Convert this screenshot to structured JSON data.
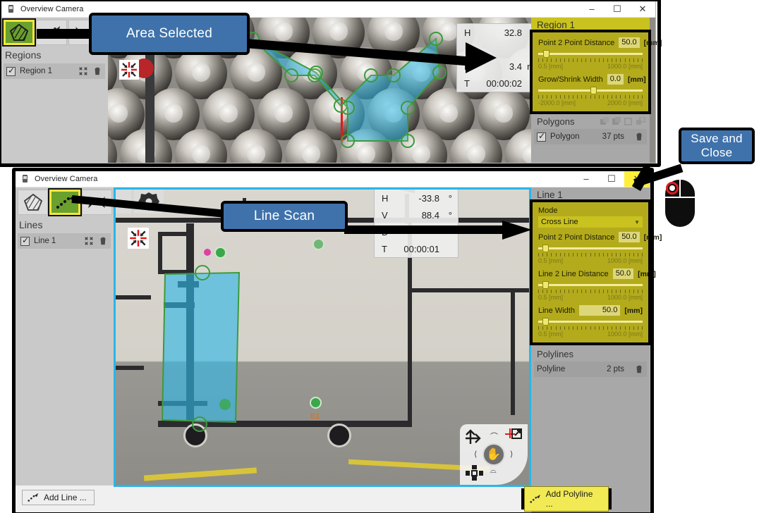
{
  "upper_window": {
    "title": "Overview Camera",
    "titlebar_icon": "camera-icon",
    "buttons": {
      "minimize": "–",
      "maximize": "☐",
      "close": "✕"
    },
    "toolbar": [
      {
        "name": "polygon-tool",
        "icon": "polygon-icon",
        "selected": true
      },
      {
        "name": "line-tool",
        "icon": "line-dots-icon",
        "selected": false
      },
      {
        "name": "curve-tool",
        "icon": "curve-icon",
        "selected": false
      }
    ],
    "sidebar": {
      "section_title": "Regions",
      "items": [
        {
          "label": "Region 1",
          "checked": true,
          "fit_icon": "fit-icon",
          "delete_icon": "trash-icon"
        }
      ]
    },
    "fit_overlay_icon": "fit-to-view-icon",
    "readout": [
      {
        "key": "H",
        "value": "32.8",
        "unit": "°"
      },
      {
        "key": "D",
        "value": "3.4",
        "unit": "m"
      },
      {
        "key": "T",
        "value": "00:00:02",
        "unit": ""
      }
    ],
    "properties": {
      "title": "Region 1",
      "fields": [
        {
          "label": "Point 2 Point Distance",
          "value": "50.0",
          "unit": "[mm]",
          "min": "0.5 [mm]",
          "max": "1000.0 [mm]",
          "knob_pct": 5
        },
        {
          "label": "Grow/Shrink Width",
          "value": "0.0",
          "unit": "[mm]",
          "min": "-2000.0 [mm]",
          "max": "2000.0 [mm]",
          "knob_pct": 50
        }
      ]
    },
    "polygons": {
      "header": "Polygons",
      "items": [
        {
          "label": "Polygon",
          "count": "37 pts",
          "checked": true,
          "delete_icon": "trash-icon"
        }
      ]
    }
  },
  "lower_window": {
    "title": "Overview Camera",
    "titlebar_icon": "camera-icon",
    "buttons": {
      "minimize": "–",
      "maximize": "☐",
      "close": "✕"
    },
    "close_highlighted": true,
    "toolbar": [
      {
        "name": "polygon-tool",
        "icon": "polygon-icon",
        "selected": false
      },
      {
        "name": "line-tool",
        "icon": "line-dots-icon",
        "selected": true
      },
      {
        "name": "curve-tool",
        "icon": "curve-icon",
        "selected": false
      }
    ],
    "sidebar": {
      "section_title": "Lines",
      "items": [
        {
          "label": "Line 1",
          "checked": true,
          "fit_icon": "fit-icon",
          "delete_icon": "trash-icon"
        }
      ]
    },
    "viewport_icons": [
      "settings-gear-icon",
      "fit-to-view-icon"
    ],
    "readout": [
      {
        "key": "H",
        "value": "-33.8",
        "unit": "°"
      },
      {
        "key": "V",
        "value": "88.4",
        "unit": "°"
      },
      {
        "key": "D",
        "value": "",
        "unit": ""
      },
      {
        "key": "T",
        "value": "00:00:01",
        "unit": ""
      }
    ],
    "properties": {
      "title": "Line 1",
      "mode_label": "Mode",
      "mode_value": "Cross Line",
      "fields": [
        {
          "label": "Point 2 Point Distance",
          "value": "50.0",
          "unit": "[mm]",
          "min": "0.5 [mm]",
          "max": "1000.0 [mm]",
          "knob_pct": 4
        },
        {
          "label": "Line 2 Line Distance",
          "value": "50.0",
          "unit": "[mm]",
          "min": "0.5 [mm]",
          "max": "1000.0 [mm]",
          "knob_pct": 4
        },
        {
          "label": "Line Width",
          "value": "50.0",
          "unit": "[mm]",
          "min": "0.5 [mm]",
          "max": "1000.0 [mm]",
          "knob_pct": 4
        }
      ]
    },
    "polylines": {
      "header": "Polylines",
      "items": [
        {
          "label": "Polyline",
          "count": "2 pts",
          "delete_icon": "trash-icon"
        }
      ]
    },
    "nav_widget": {
      "pan_icon": "hand-icon",
      "move_icon": "move-arrows-icon",
      "center_icon": "center-target-icon",
      "expand_icon": "expand-icon",
      "left_icon": "⟨",
      "right_icon": "⟩",
      "up_icon": "⌒",
      "down_icon": "⌓"
    },
    "footer": {
      "add_line": {
        "label": "Add Line ...",
        "icon": "line-dots-icon"
      },
      "add_polyline": {
        "label": "Add Polyline ...",
        "icon": "polyline-icon",
        "highlighted": true
      }
    },
    "image_label": "E1"
  },
  "annotations": [
    {
      "name": "area-selected-callout",
      "text": "Area Selected"
    },
    {
      "name": "line-scan-callout",
      "text": "Line Scan"
    },
    {
      "name": "save-and-close-callout",
      "text": "Save and\nClose"
    }
  ],
  "annotation_texts": {
    "area_selected": "Area Selected",
    "line_scan": "Line Scan",
    "save_and_close_line1": "Save and",
    "save_and_close_line2": "Close"
  },
  "colors": {
    "callout_blue": "#3f72ab",
    "selection_cyan": "#3cb8e0",
    "handle_green": "#3d9a3d",
    "panel_yellow": "#b3ab1c",
    "highlight_yellow": "#f2ea55",
    "tool_selected_green": "#6aa02e",
    "window_border_blue": "#29b6e8"
  }
}
